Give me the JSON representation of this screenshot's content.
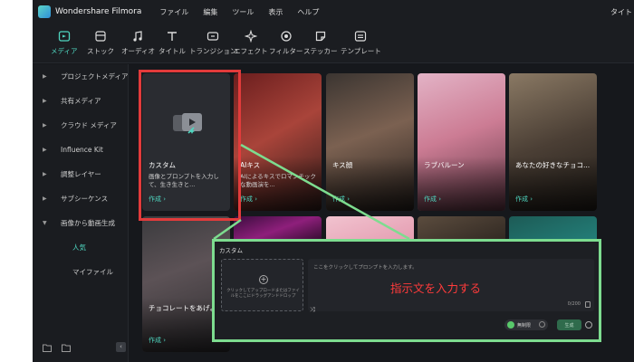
{
  "app": {
    "name": "Wondershare Filmora",
    "title_right": "タイト"
  },
  "menu": [
    "ファイル",
    "編集",
    "ツール",
    "表示",
    "ヘルプ"
  ],
  "toolbar": [
    {
      "label": "メディア",
      "icon": "media-icon",
      "active": true
    },
    {
      "label": "ストック",
      "icon": "stock-icon"
    },
    {
      "label": "オーディオ",
      "icon": "music-note-icon"
    },
    {
      "label": "タイトル",
      "icon": "title-t-icon"
    },
    {
      "label": "トランジション",
      "icon": "transition-icon"
    },
    {
      "label": "エフェクト",
      "icon": "effect-sparkle-icon"
    },
    {
      "label": "フィルター",
      "icon": "filter-icon"
    },
    {
      "label": "ステッカー",
      "icon": "sticker-icon"
    },
    {
      "label": "テンプレート",
      "icon": "template-icon"
    }
  ],
  "sidebar": {
    "items": [
      "プロジェクトメディア",
      "共有メディア",
      "クラウド メディア",
      "Influence Kit",
      "調整レイヤー",
      "サブシーケンス",
      "画像から動画生成"
    ],
    "sub_items": [
      "人気",
      "マイファイル"
    ],
    "active_sub": "人気"
  },
  "cards": [
    {
      "title": "カスタム",
      "desc": "画像とプロンプトを入力して、生き生きと...",
      "button": "作成 ›"
    },
    {
      "title": "AIキス",
      "desc": "AIによるキスでロマンチックな動画演を...",
      "button": "作成 ›"
    },
    {
      "title": "キス顔",
      "button": "作成 ›"
    },
    {
      "title": "ラブバルーン",
      "button": "作成 ›"
    },
    {
      "title": "あなたの好きなチョコ...",
      "button": "作成 ›"
    },
    {
      "title": "チョコレートをあげよう",
      "button": "作成 ›"
    }
  ],
  "panel": {
    "title": "カスタム",
    "upload_text": "クリックしてアップロードまたはファイルをここにドラッグアンドドロップ",
    "placeholder": "ここをクリックしてプロンプトを入力します。",
    "overlay_text": "指示文を入力する",
    "count": "0/200",
    "pill_label": "無制限",
    "generate": "生成"
  },
  "colors": {
    "accent": "#4fd6c0",
    "highlight_red": "#e23b3b",
    "highlight_green": "#7ddc8f"
  }
}
